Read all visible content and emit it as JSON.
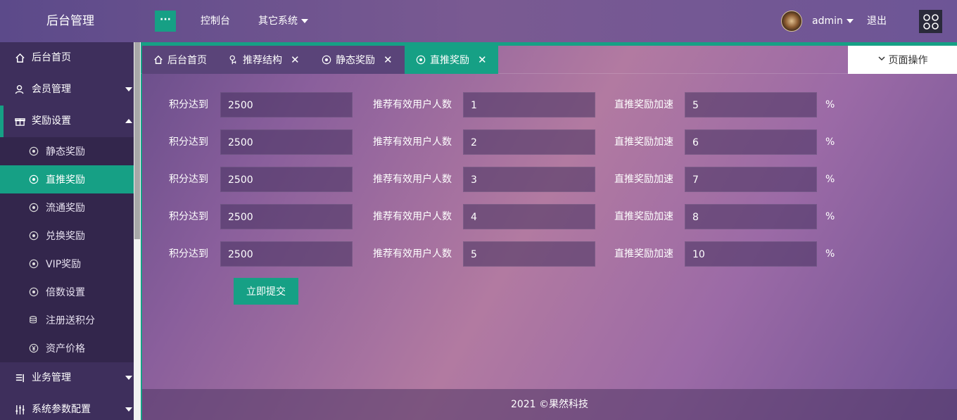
{
  "header": {
    "title": "后台管理",
    "menu_toggle": "···",
    "nav": [
      "控制台",
      "其它系统"
    ],
    "user": "admin",
    "logout": "退出"
  },
  "sidebar": {
    "items": [
      {
        "label": "后台首页",
        "icon": "home-icon"
      },
      {
        "label": "会员管理",
        "icon": "user-icon"
      },
      {
        "label": "奖励设置",
        "icon": "gift-icon"
      },
      {
        "label": "业务管理",
        "icon": "list-icon"
      },
      {
        "label": "系统参数配置",
        "icon": "sliders-icon"
      }
    ],
    "sub_items": [
      {
        "label": "静态奖励",
        "icon": "settings-icon"
      },
      {
        "label": "直推奖励",
        "icon": "settings-icon"
      },
      {
        "label": "流通奖励",
        "icon": "settings-icon"
      },
      {
        "label": "兑换奖励",
        "icon": "settings-icon"
      },
      {
        "label": "VIP奖励",
        "icon": "settings-icon"
      },
      {
        "label": "倍数设置",
        "icon": "settings-icon"
      },
      {
        "label": "注册送积分",
        "icon": "database-icon"
      },
      {
        "label": "资产价格",
        "icon": "yen-icon"
      }
    ]
  },
  "tabs": [
    {
      "label": "后台首页",
      "closable": false
    },
    {
      "label": "推荐结构",
      "closable": true
    },
    {
      "label": "静态奖励",
      "closable": true
    },
    {
      "label": "直推奖励",
      "closable": true
    }
  ],
  "page_ops": "页面操作",
  "form": {
    "label_points": "积分达到",
    "label_users": "推荐有效用户人数",
    "label_speed": "直推奖励加速",
    "percent": "%",
    "rows": [
      {
        "points": "2500",
        "users": "1",
        "speed": "5"
      },
      {
        "points": "2500",
        "users": "2",
        "speed": "6"
      },
      {
        "points": "2500",
        "users": "3",
        "speed": "7"
      },
      {
        "points": "2500",
        "users": "4",
        "speed": "8"
      },
      {
        "points": "2500",
        "users": "5",
        "speed": "10"
      }
    ],
    "submit": "立即提交"
  },
  "footer": "2021 ©果然科技",
  "colors": {
    "accent": "#16a085",
    "sidebar": "#3e2f5c"
  }
}
